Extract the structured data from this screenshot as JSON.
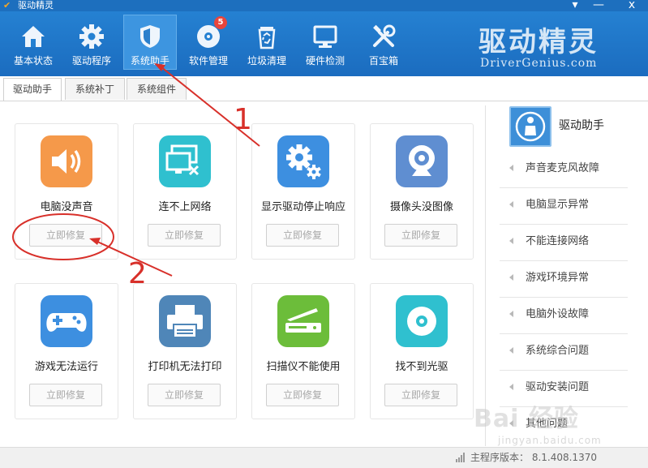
{
  "titlebar": {
    "title": "驱动精灵",
    "menu_glyph": "▾",
    "minimize_glyph": "—",
    "close_glyph": "x"
  },
  "nav": [
    {
      "label": "基本状态",
      "icon": "home-icon"
    },
    {
      "label": "驱动程序",
      "icon": "gear-icon"
    },
    {
      "label": "系统助手",
      "icon": "shield-icon"
    },
    {
      "label": "软件管理",
      "icon": "disc-icon",
      "badge": "5"
    },
    {
      "label": "垃圾清理",
      "icon": "recycle-bin-icon"
    },
    {
      "label": "硬件检测",
      "icon": "monitor-icon"
    },
    {
      "label": "百宝箱",
      "icon": "tools-icon"
    }
  ],
  "brand": {
    "title": "驱动精灵",
    "subtitle": "DriverGenius.com"
  },
  "tabs": [
    {
      "label": "驱动助手"
    },
    {
      "label": "系统补丁"
    },
    {
      "label": "系统组件"
    }
  ],
  "cards": [
    {
      "title": "电脑没声音",
      "button": "立即修复",
      "icon": "speaker-icon",
      "color": "#f5994a"
    },
    {
      "title": "连不上网络",
      "button": "立即修复",
      "icon": "network-disconnected-icon",
      "color": "#2fc0cf"
    },
    {
      "title": "显示驱动停止响应",
      "button": "立即修复",
      "icon": "display-gear-icon",
      "color": "#3d8fe0"
    },
    {
      "title": "摄像头没图像",
      "button": "立即修复",
      "icon": "webcam-icon",
      "color": "#5f8ed1"
    },
    {
      "title": "游戏无法运行",
      "button": "立即修复",
      "icon": "gamepad-icon",
      "color": "#3d8fe0"
    },
    {
      "title": "打印机无法打印",
      "button": "立即修复",
      "icon": "printer-icon",
      "color": "#4f86b8"
    },
    {
      "title": "扫描仪不能使用",
      "button": "立即修复",
      "icon": "scanner-icon",
      "color": "#6cbd3a"
    },
    {
      "title": "找不到光驱",
      "button": "立即修复",
      "icon": "optical-drive-icon",
      "color": "#2fc0cf"
    }
  ],
  "sidebar": {
    "title": "驱动助手",
    "items": [
      {
        "label": "声音麦克风故障"
      },
      {
        "label": "电脑显示异常"
      },
      {
        "label": "不能连接网络"
      },
      {
        "label": "游戏环境异常"
      },
      {
        "label": "电脑外设故障"
      },
      {
        "label": "系统综合问题"
      },
      {
        "label": "驱动安装问题"
      },
      {
        "label": "其他问题"
      }
    ]
  },
  "status": {
    "version_text": "主程序版本： 8.1.408.1370"
  },
  "watermark": {
    "text": "Bai 经验",
    "sub": "jingyan.baidu.com"
  },
  "annotations": {
    "step1": "1",
    "step2": "2",
    "color": "#d8302a"
  }
}
